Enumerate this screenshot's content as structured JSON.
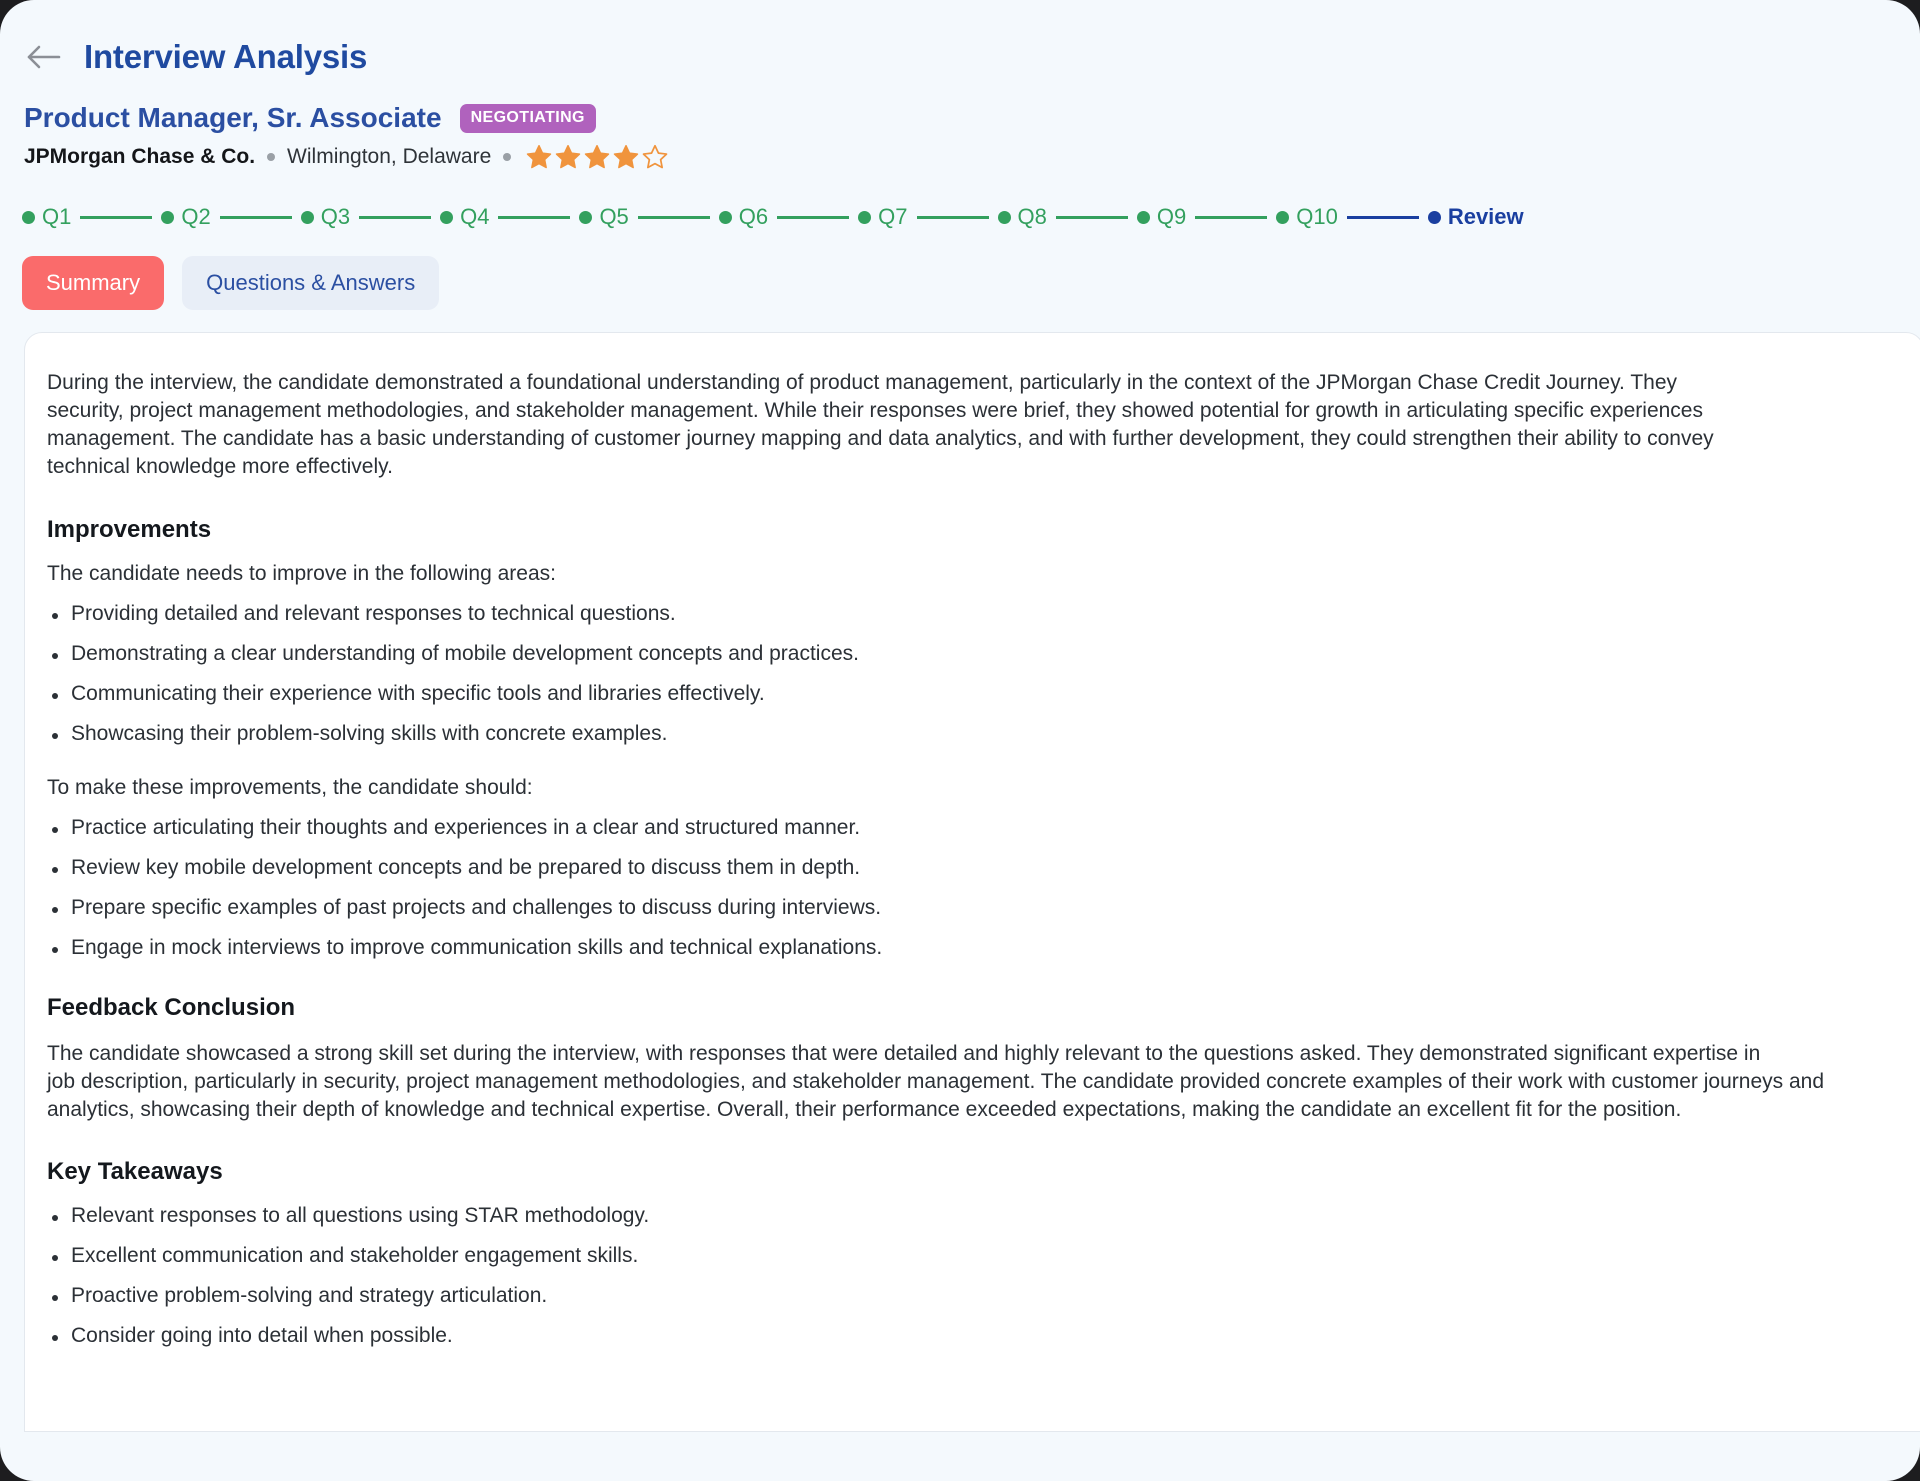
{
  "header": {
    "back_icon": "arrow-left-icon",
    "title": "Interview Analysis"
  },
  "job": {
    "title": "Product Manager, Sr. Associate",
    "status": "NEGOTIATING",
    "company": "JPMorgan Chase & Co.",
    "location": "Wilmington, Delaware",
    "rating_filled": 4,
    "rating_total": 5,
    "accent_badge_color": "#b062bd",
    "star_color": "#f0943d"
  },
  "stepper": {
    "steps": [
      {
        "label": "Q1",
        "state": "done"
      },
      {
        "label": "Q2",
        "state": "done"
      },
      {
        "label": "Q3",
        "state": "done"
      },
      {
        "label": "Q4",
        "state": "done"
      },
      {
        "label": "Q5",
        "state": "done"
      },
      {
        "label": "Q6",
        "state": "done"
      },
      {
        "label": "Q7",
        "state": "done"
      },
      {
        "label": "Q8",
        "state": "done"
      },
      {
        "label": "Q9",
        "state": "done"
      },
      {
        "label": "Q10",
        "state": "done"
      },
      {
        "label": "Review",
        "state": "current"
      }
    ],
    "done_color": "#33a05e",
    "current_color": "#1a3fa0"
  },
  "tabs": [
    {
      "label": "Summary",
      "active": true
    },
    {
      "label": "Questions & Answers",
      "active": false
    }
  ],
  "summary": {
    "intro_lines": [
      "During the interview, the candidate demonstrated a foundational understanding of product management, particularly in the context of the JPMorgan Chase Credit Journey. They",
      "security, project management methodologies, and stakeholder management. While their responses were brief, they showed potential for growth in articulating specific experiences",
      "management. The candidate has a basic understanding of customer journey mapping and data analytics, and with further development, they could strengthen their ability to convey",
      "technical knowledge more effectively."
    ],
    "improvements": {
      "heading": "Improvements",
      "lead": "The candidate needs to improve in the following areas:",
      "items": [
        "Providing detailed and relevant responses to technical questions.",
        "Demonstrating a clear understanding of mobile development concepts and practices.",
        "Communicating their experience with specific tools and libraries effectively.",
        "Showcasing their problem-solving skills with concrete examples."
      ],
      "lead2": "To make these improvements, the candidate should:",
      "items2": [
        "Practice articulating their thoughts and experiences in a clear and structured manner.",
        "Review key mobile development concepts and be prepared to discuss them in depth.",
        "Prepare specific examples of past projects and challenges to discuss during interviews.",
        "Engage in mock interviews to improve communication skills and technical explanations."
      ]
    },
    "conclusion": {
      "heading": "Feedback Conclusion",
      "lines": [
        "The candidate showcased a strong skill set during the interview, with responses that were detailed and highly relevant to the questions asked. They demonstrated significant expertise in",
        "job description, particularly in security, project management methodologies, and stakeholder management. The candidate provided concrete examples of their work with customer journeys and",
        "analytics, showcasing their depth of knowledge and technical expertise. Overall, their performance exceeded expectations, making the candidate an excellent fit for the position."
      ]
    },
    "takeaways": {
      "heading": "Key Takeaways",
      "items": [
        "Relevant responses to all questions using STAR methodology.",
        "Excellent communication and stakeholder engagement skills.",
        "Proactive problem-solving and strategy articulation.",
        "Consider going into detail when possible."
      ]
    }
  }
}
